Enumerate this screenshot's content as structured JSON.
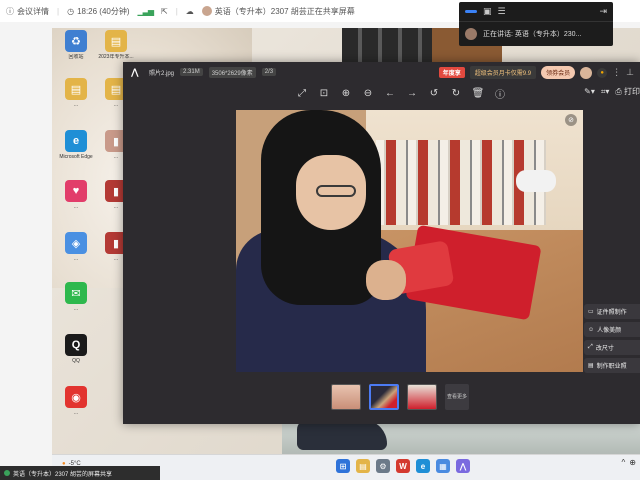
{
  "meeting_bar": {
    "details_label": "会议详情",
    "time_label": "18:26 (40分钟)",
    "sharer_label": "英语（专升本）2307 胡芸正在共享屏幕"
  },
  "desktop_icons": [
    {
      "label": "回收站",
      "color": "#3f7fd1",
      "glyph": "♻"
    },
    {
      "label": "2023年专升本...",
      "color": "#e3b448",
      "glyph": "▤"
    },
    {
      "label": "...",
      "color": "#e3b448",
      "glyph": "▤"
    },
    {
      "label": "...",
      "color": "#e3b448",
      "glyph": "▤"
    },
    {
      "label": "Microsoft Edge",
      "color": "#1f8fd6",
      "glyph": "e"
    },
    {
      "label": "...",
      "color": "#c99a8a",
      "glyph": "▮"
    },
    {
      "label": "...",
      "color": "#e23d6a",
      "glyph": "♥"
    },
    {
      "label": "...",
      "color": "#b43a35",
      "glyph": "▮"
    },
    {
      "label": "...",
      "color": "#4a90e2",
      "glyph": "◈"
    },
    {
      "label": "...",
      "color": "#b43a35",
      "glyph": "▮"
    },
    {
      "label": "...",
      "color": "#2eb84d",
      "glyph": "✉"
    },
    {
      "label": "QQ",
      "color": "#1a1a1a",
      "glyph": "Q"
    },
    {
      "label": "...",
      "color": "#e2342f",
      "glyph": "◉"
    }
  ],
  "viewer": {
    "file_name": "照片2.jpg",
    "file_size": "2.31M",
    "dimensions": "3506*2629像素",
    "page_index": "2/3",
    "vip_tag": "年度享",
    "vip_promo": "超级会员月卡仅需9.9",
    "vip_button": "领券会员",
    "print_label": "打印",
    "side_buttons": [
      {
        "icon": "▭",
        "label": "证件照制作"
      },
      {
        "icon": "☺",
        "label": "人像美颜"
      },
      {
        "icon": "⤢",
        "label": "改尺寸"
      },
      {
        "icon": "▤",
        "label": "制作职业照"
      }
    ],
    "more_label": "查看更多"
  },
  "meeting_panel": {
    "speaking_label": "正在讲话: 英语（专升本）230..."
  },
  "taskbar": {
    "temperature": "-5°C"
  },
  "share_bar": {
    "text": "英语（专升本）2307 胡芸的屏幕共享"
  }
}
